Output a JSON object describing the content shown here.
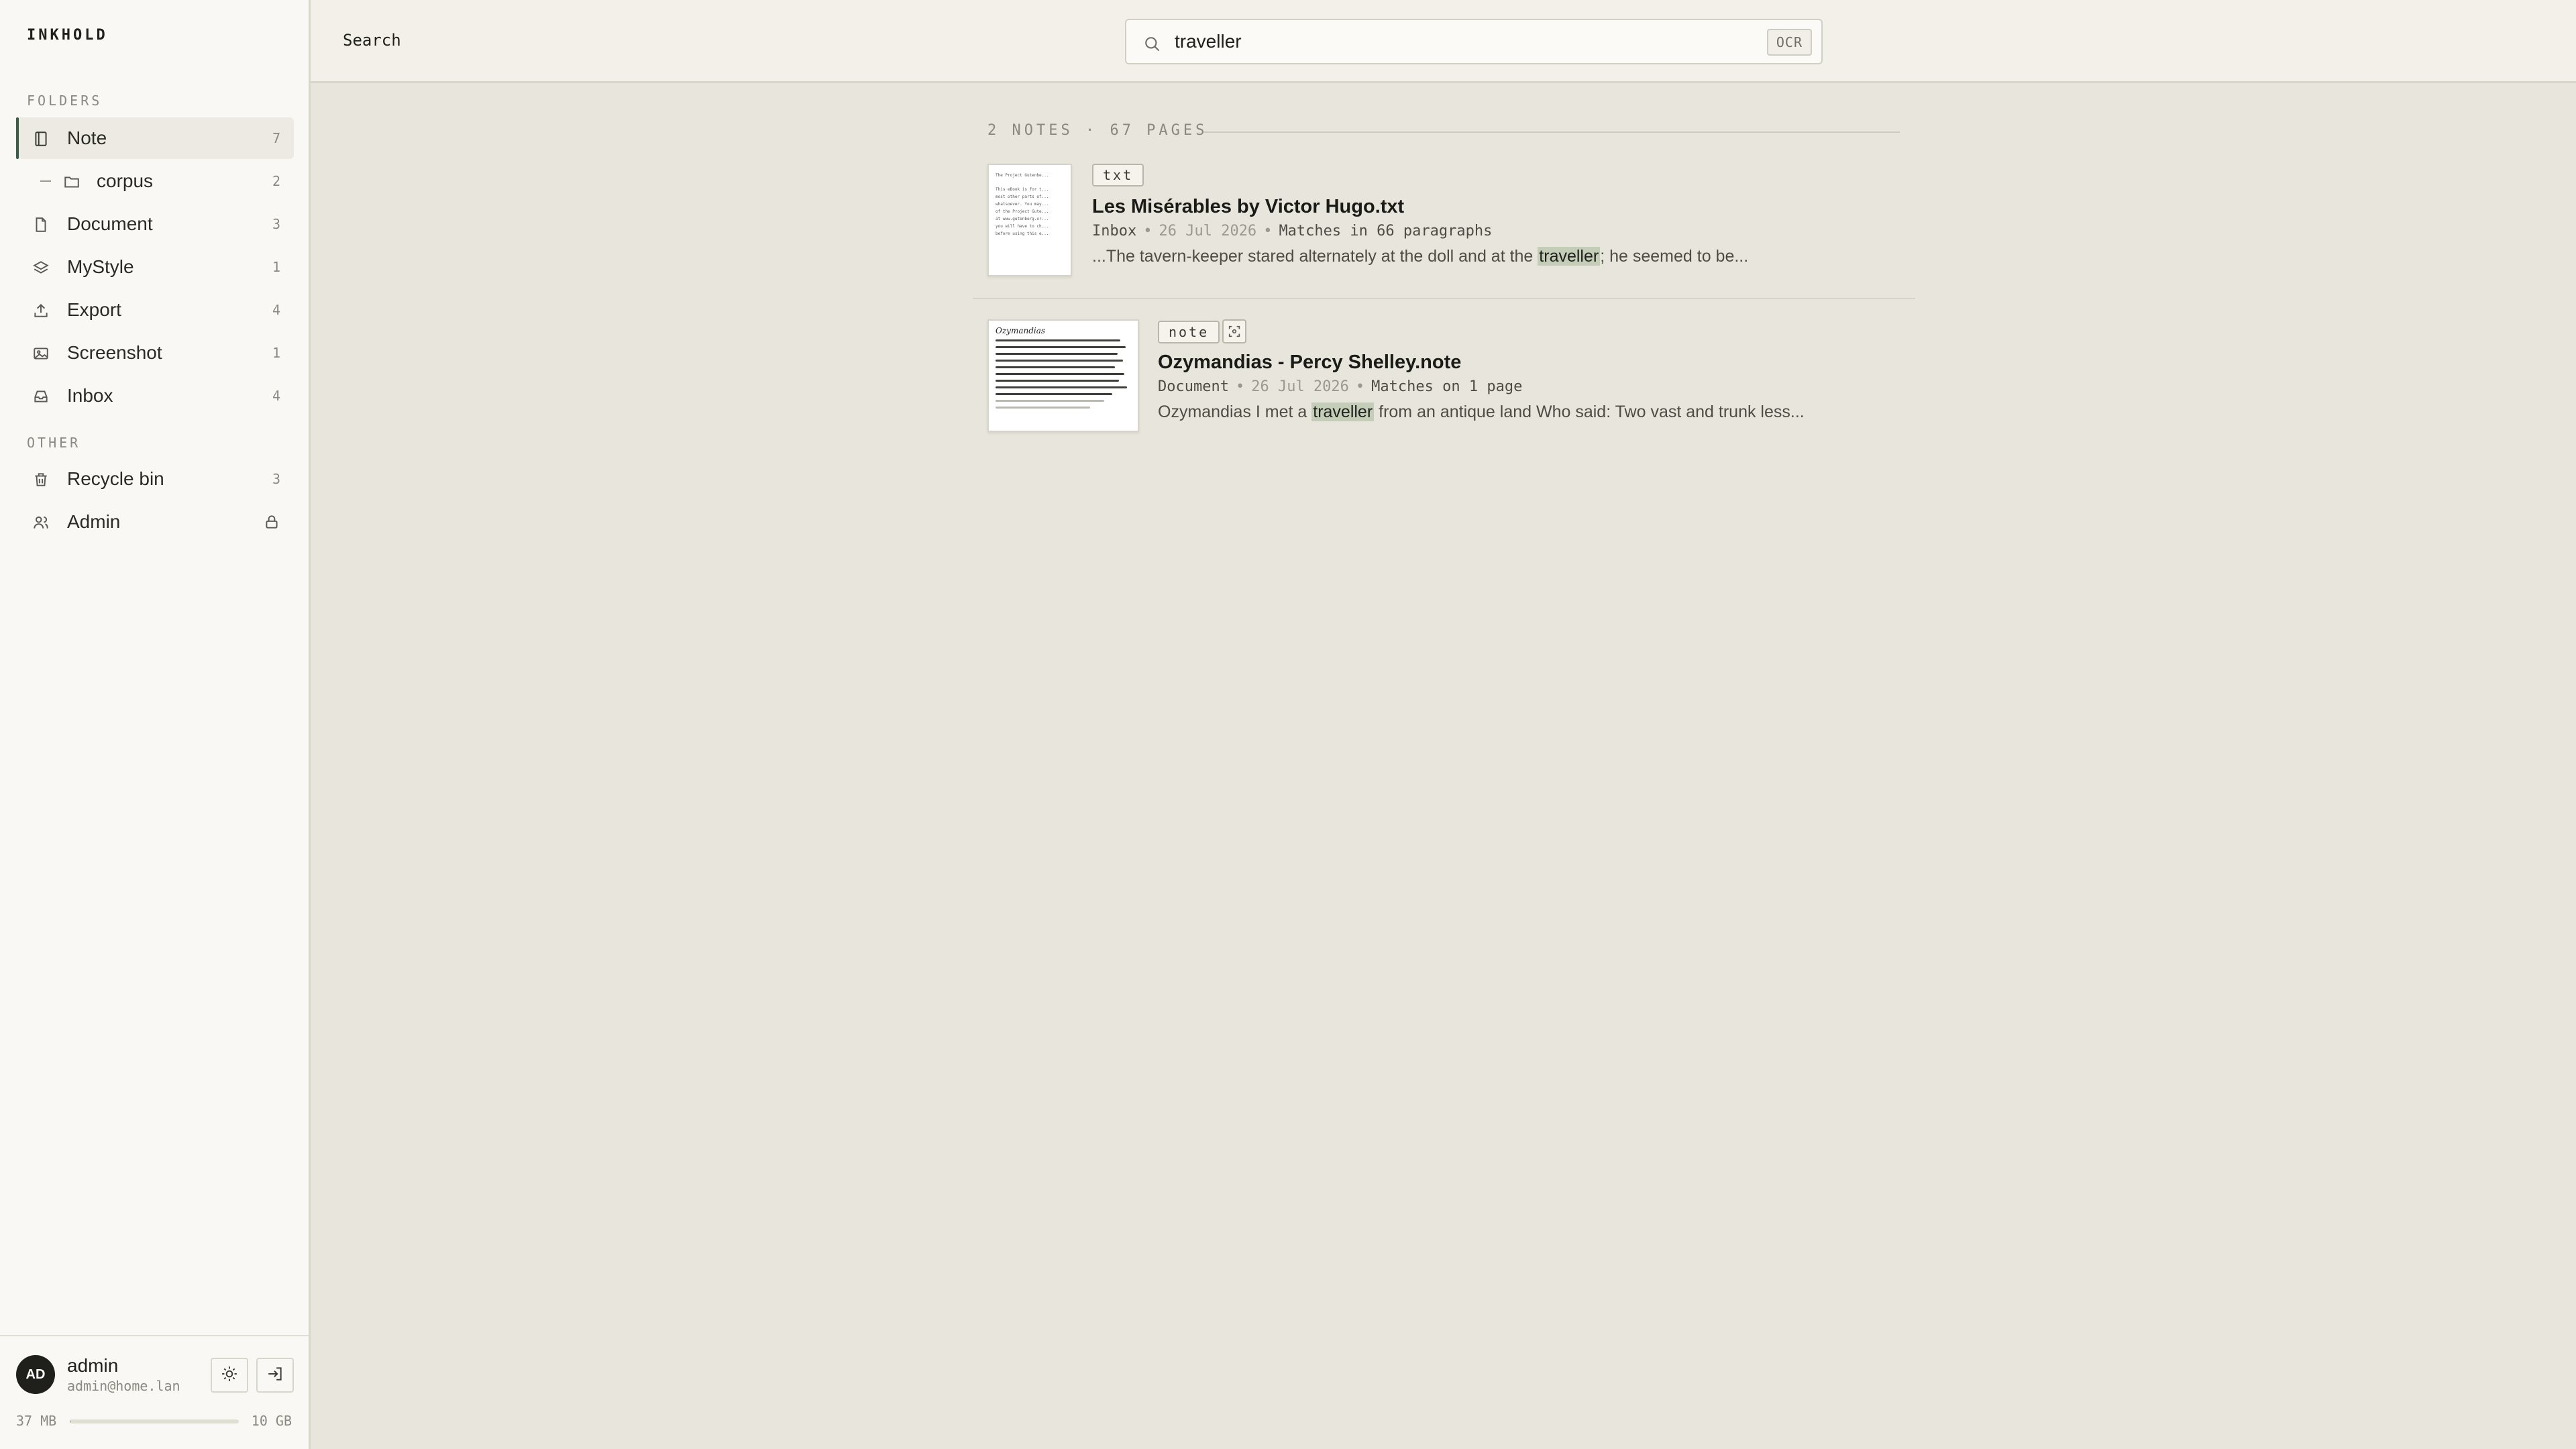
{
  "app": {
    "logo": "INKHOLD"
  },
  "sidebar": {
    "folders_label": "FOLDERS",
    "folders": [
      {
        "label": "Note",
        "count": "7",
        "icon": "notebook-icon",
        "active": true
      },
      {
        "label": "corpus",
        "count": "2",
        "icon": "folder-icon",
        "sub": true
      },
      {
        "label": "Document",
        "count": "3",
        "icon": "file-icon"
      },
      {
        "label": "MyStyle",
        "count": "1",
        "icon": "layers-icon"
      },
      {
        "label": "Export",
        "count": "4",
        "icon": "upload-icon"
      },
      {
        "label": "Screenshot",
        "count": "1",
        "icon": "image-icon"
      },
      {
        "label": "Inbox",
        "count": "4",
        "icon": "inbox-icon"
      }
    ],
    "other_label": "OTHER",
    "other": [
      {
        "label": "Recycle bin",
        "count": "3",
        "icon": "trash-icon"
      },
      {
        "label": "Admin",
        "icon": "users-icon",
        "lock_icon": "lock-icon"
      }
    ]
  },
  "user": {
    "initials": "AD",
    "name": "admin",
    "email": "admin@home.lan",
    "theme_button_icon": "sun-icon",
    "logout_button_icon": "logout-icon"
  },
  "storage": {
    "used": "37 MB",
    "total": "10 GB",
    "fraction": 0.004
  },
  "topbar": {
    "title": "Search",
    "search_value": "traveller",
    "search_icon": "search-icon",
    "ocr_badge": "OCR"
  },
  "results": {
    "summary": "2 NOTES · 67 PAGES",
    "items": [
      {
        "tag": "txt",
        "title": "Les Misérables by Victor Hugo.txt",
        "folder": "Inbox",
        "date": "26 Jul 2026",
        "matches": "Matches in 66 paragraphs",
        "snippet_before": "...The tavern-keeper stared alternately at the doll and at the ",
        "snippet_highlight": "traveller",
        "snippet_after": "; he seemed to be...",
        "thumb_title": "The Project Gutenbe...",
        "thumb_lines": [
          "This eBook is for t...",
          "most other parts of...",
          "whatsoever. You may...",
          "of the Project Gute...",
          "at www.gutenberg.or...",
          "you will have to ch...",
          "before using this e..."
        ]
      },
      {
        "tag": "note",
        "tag_icon": "ocr-scan-icon",
        "title": "Ozymandias - Percy Shelley.note",
        "folder": "Document",
        "date": "26 Jul 2026",
        "matches": "Matches on 1 page",
        "snippet_before": "Ozymandias I met a ",
        "snippet_highlight": "traveller",
        "snippet_after": " from an antique land Who said: Two vast and trunk less...",
        "thumb_title": "Ozymandias"
      }
    ]
  },
  "colors": {
    "accent": "#3c5a44",
    "highlight": "#c4cdb7",
    "background": "#e8e6dc",
    "sidebar": "#f9f8f4"
  }
}
